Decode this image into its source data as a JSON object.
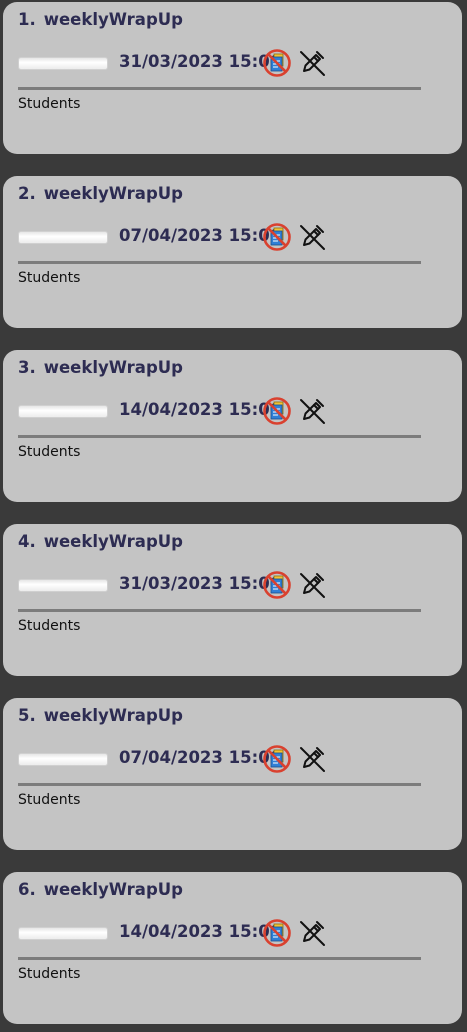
{
  "tasks": [
    {
      "index": "1.",
      "name": "weeklyWrapUp",
      "datetime": "31/03/2023 15:06",
      "progress": 0,
      "tag": "Students"
    },
    {
      "index": "2.",
      "name": "weeklyWrapUp",
      "datetime": "07/04/2023 15:06",
      "progress": 0,
      "tag": "Students"
    },
    {
      "index": "3.",
      "name": "weeklyWrapUp",
      "datetime": "14/04/2023 15:06",
      "progress": 0,
      "tag": "Students"
    },
    {
      "index": "4.",
      "name": "weeklyWrapUp",
      "datetime": "31/03/2023 15:06",
      "progress": 0,
      "tag": "Students"
    },
    {
      "index": "5.",
      "name": "weeklyWrapUp",
      "datetime": "07/04/2023 15:06",
      "progress": 0,
      "tag": "Students"
    },
    {
      "index": "6.",
      "name": "weeklyWrapUp",
      "datetime": "14/04/2023 15:06",
      "progress": 0,
      "tag": "Students"
    }
  ],
  "icons": {
    "status": "not-done-document-icon",
    "edit": "edit-disabled-icon"
  },
  "colors": {
    "background": "#3a3a3a",
    "card": "#c4c4c4",
    "title_text": "#2d2c52",
    "divider": "#7c7c7c",
    "forbidden_red": "#d9412f",
    "document_blue": "#2f7fd6",
    "document_yellow": "#f2c232"
  }
}
